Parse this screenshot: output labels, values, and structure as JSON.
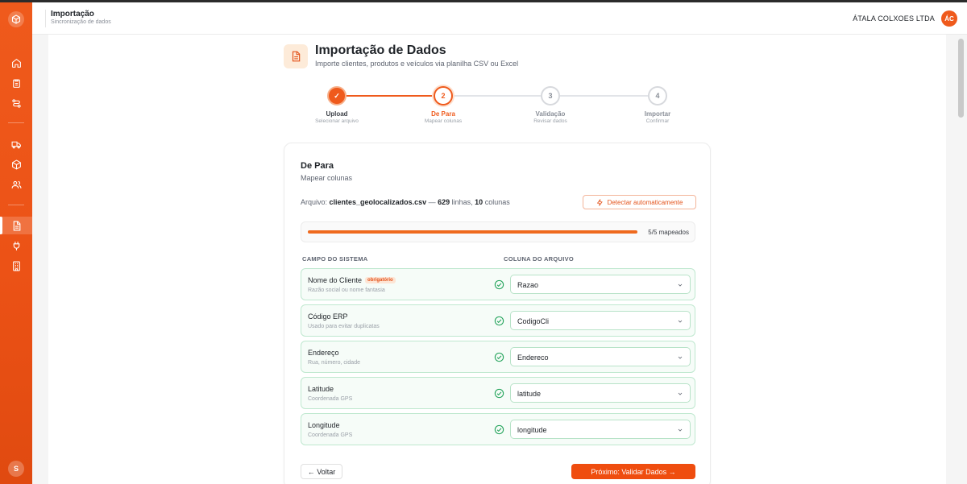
{
  "header": {
    "title": "Importação",
    "subtitle": "Sincronização de dados",
    "company": "ÁTALA COLXOES LTDA",
    "avatar_initials": "ÁC"
  },
  "sidebar": {
    "user_initial": "S",
    "icons": [
      "home-icon",
      "clipboard-icon",
      "routes-icon",
      "truck-icon",
      "box-icon",
      "users-icon",
      "import-file-icon",
      "plug-icon",
      "building-icon"
    ],
    "active_item": "import-file-icon"
  },
  "page": {
    "title": "Importação de Dados",
    "subtitle": "Importe clientes, produtos e veículos via planilha CSV ou Excel"
  },
  "steps": [
    {
      "number": "✓",
      "label": "Upload",
      "desc": "Selecionar arquivo",
      "state": "done"
    },
    {
      "number": "2",
      "label": "De Para",
      "desc": "Mapear colunas",
      "state": "current"
    },
    {
      "number": "3",
      "label": "Validação",
      "desc": "Revisar dados",
      "state": "todo"
    },
    {
      "number": "4",
      "label": "Importar",
      "desc": "Confirmar",
      "state": "todo"
    }
  ],
  "card": {
    "title": "De Para",
    "subtitle": "Mapear colunas",
    "file_prefix": "Arquivo: ",
    "file_name": "clientes_geolocalizados.csv",
    "file_sep": " — ",
    "rows_count": "629",
    "rows_label": " linhas, ",
    "cols_count": "10",
    "cols_label": " colunas",
    "detect_button": "Detectar automaticamente",
    "progress_fraction": 1.0,
    "progress_text": "5/5 mapeados",
    "col_system": "CAMPO DO SISTEMA",
    "col_file": "COLUNA DO ARQUIVO",
    "required_badge": "obrigatório",
    "back_button": "← Voltar",
    "next_button": "Próximo: Validar Dados →"
  },
  "mappings": [
    {
      "field": "Nome do Cliente",
      "desc": "Razão social ou nome fantasia",
      "required": true,
      "value": "Razao"
    },
    {
      "field": "Código ERP",
      "desc": "Usado para evitar duplicatas",
      "required": false,
      "value": "CodigoCli"
    },
    {
      "field": "Endereço",
      "desc": "Rua, número, cidade",
      "required": false,
      "value": "Endereco"
    },
    {
      "field": "Latitude",
      "desc": "Coordenada GPS",
      "required": false,
      "value": "latitude"
    },
    {
      "field": "Longitude",
      "desc": "Coordenada GPS",
      "required": false,
      "value": "longitude"
    }
  ],
  "colors": {
    "accent": "#ef5a1c",
    "success": "#22a35a"
  }
}
